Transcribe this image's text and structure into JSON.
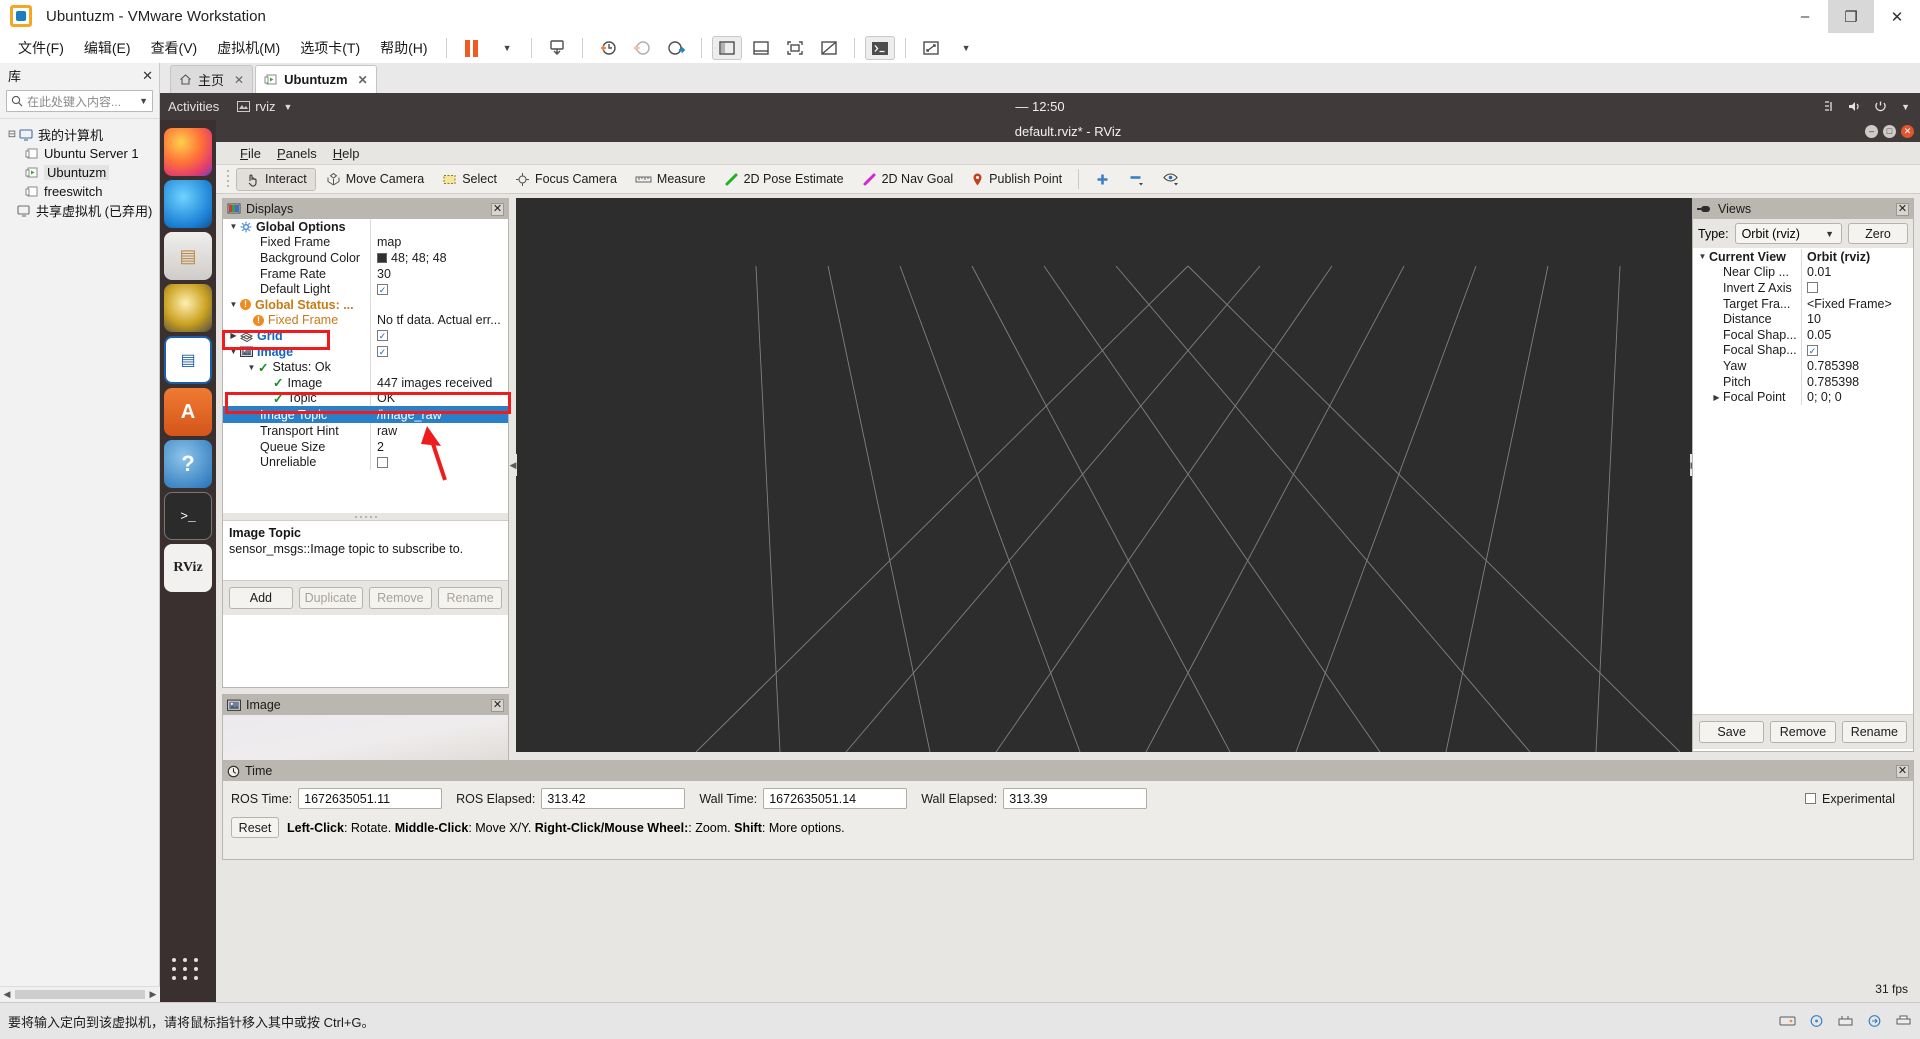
{
  "vmware": {
    "title": "Ubuntuzm - VMware Workstation",
    "menus": [
      "文件(F)",
      "编辑(E)",
      "查看(V)",
      "虚拟机(M)",
      "选项卡(T)",
      "帮助(H)"
    ],
    "window_controls": [
      "–",
      "❐",
      "✕"
    ],
    "library": {
      "header": "库",
      "close": "✕",
      "search_placeholder": "在此处键入内容...",
      "search_icon": "search-icon",
      "tree": [
        {
          "label": "我的计算机",
          "level": 0,
          "expander": "⊟",
          "icon": "computer-icon",
          "selected": false
        },
        {
          "label": "Ubuntu Server 1",
          "level": 1,
          "expander": "",
          "icon": "vm-icon",
          "selected": false
        },
        {
          "label": "Ubuntuzm",
          "level": 1,
          "expander": "",
          "icon": "vm-running-icon",
          "selected": true
        },
        {
          "label": "freeswitch",
          "level": 1,
          "expander": "",
          "icon": "vm-icon",
          "selected": false
        },
        {
          "label": "共享虚拟机 (已弃用)",
          "level": 0,
          "expander": "",
          "icon": "shared-vm-icon",
          "selected": false
        }
      ]
    },
    "tabs": [
      {
        "label": "主页",
        "icon": "home-icon",
        "active": false
      },
      {
        "label": "Ubuntuzm",
        "icon": "vm-running-icon",
        "active": true
      }
    ],
    "statusbar": {
      "message": "要将输入定向到该虚拟机，请将鼠标指针移入其中或按 Ctrl+G。"
    }
  },
  "gnome": {
    "activities": "Activities",
    "app_name": "rviz",
    "clock": "12:50",
    "clock_prefix": "—"
  },
  "rviz": {
    "window_title": "default.rviz* - RViz",
    "menus": [
      "File",
      "Panels",
      "Help"
    ],
    "toolbar": [
      {
        "label": "Interact",
        "icon": "hand-cursor-icon",
        "active": true
      },
      {
        "label": "Move Camera",
        "icon": "move-camera-icon",
        "active": false
      },
      {
        "label": "Select",
        "icon": "select-rect-icon",
        "active": false
      },
      {
        "label": "Focus Camera",
        "icon": "focus-camera-icon",
        "active": false
      },
      {
        "label": "Measure",
        "icon": "ruler-icon",
        "active": false
      },
      {
        "label": "2D Pose Estimate",
        "icon": "green-arrow-icon",
        "active": false
      },
      {
        "label": "2D Nav Goal",
        "icon": "magenta-arrow-icon",
        "active": false
      },
      {
        "label": "Publish Point",
        "icon": "map-pin-icon",
        "active": false
      }
    ],
    "toolbar_extra": [
      "plus-icon",
      "minus-icon",
      "eye-icon"
    ],
    "displays": {
      "title": "Displays",
      "icon": "displays-icon",
      "close": "✕",
      "rows": [
        {
          "name": "Global Options",
          "value": "",
          "indent": 1,
          "expander": "▼",
          "icon": "gear-icon",
          "bold": true,
          "style": "plain"
        },
        {
          "name": "Fixed Frame",
          "value": "map",
          "indent": 3,
          "expander": "",
          "icon": "",
          "style": "plain"
        },
        {
          "name": "Background Color",
          "value": "48; 48; 48",
          "indent": 3,
          "expander": "",
          "icon": "",
          "style": "swatch"
        },
        {
          "name": "Frame Rate",
          "value": "30",
          "indent": 3,
          "expander": "",
          "icon": "",
          "style": "plain"
        },
        {
          "name": "Default Light",
          "value": "✓",
          "indent": 3,
          "expander": "",
          "icon": "",
          "style": "checkbox"
        },
        {
          "name": "Global Status: ...",
          "value": "",
          "indent": 1,
          "expander": "▼",
          "icon": "warning-icon",
          "style": "orange"
        },
        {
          "name": "Fixed Frame",
          "value": "No tf data.  Actual err...",
          "indent": 3,
          "expander": "",
          "icon": "warning-icon",
          "style": "orange"
        },
        {
          "name": "Grid",
          "value": "✓",
          "indent": 1,
          "expander": "▶",
          "icon": "grid-icon",
          "style": "blue-checkbox"
        },
        {
          "name": "Image",
          "value": "✓",
          "indent": 1,
          "expander": "▼",
          "icon": "image-icon",
          "style": "blue-checkbox"
        },
        {
          "name": "Status: Ok",
          "value": "",
          "indent": 3,
          "expander": "▼",
          "icon": "check-icon",
          "style": "plain"
        },
        {
          "name": "Image",
          "value": "447 images received",
          "indent": 5,
          "expander": "",
          "icon": "check-icon",
          "style": "plain"
        },
        {
          "name": "Topic",
          "value": "OK",
          "indent": 5,
          "expander": "",
          "icon": "check-icon",
          "style": "plain"
        },
        {
          "name": "Image Topic",
          "value": "/image_raw",
          "indent": 4,
          "expander": "",
          "icon": "",
          "style": "selected"
        },
        {
          "name": "Transport Hint",
          "value": "raw",
          "indent": 4,
          "expander": "",
          "icon": "",
          "style": "plain"
        },
        {
          "name": "Queue Size",
          "value": "2",
          "indent": 4,
          "expander": "",
          "icon": "",
          "style": "plain"
        },
        {
          "name": "Unreliable",
          "value": "",
          "indent": 4,
          "expander": "",
          "icon": "",
          "style": "empty-checkbox"
        }
      ],
      "description_title": "Image Topic",
      "description_text": "sensor_msgs::Image topic to subscribe to.",
      "buttons": [
        {
          "label": "Add",
          "enabled": true
        },
        {
          "label": "Duplicate",
          "enabled": false
        },
        {
          "label": "Remove",
          "enabled": false
        },
        {
          "label": "Rename",
          "enabled": false
        }
      ]
    },
    "image_panel": {
      "title": "Image",
      "icon": "image-icon",
      "close": "✕"
    },
    "views": {
      "title": "Views",
      "icon": "views-camera-icon",
      "close": "✕",
      "type_label": "Type:",
      "type_value": "Orbit (rviz)",
      "zero_button": "Zero",
      "rows": [
        {
          "name": "Current View",
          "value": "Orbit (rviz)",
          "indent": 1,
          "expander": "▼",
          "bold": true,
          "style": "plain"
        },
        {
          "name": "Near Clip ...",
          "value": "0.01",
          "indent": 3,
          "expander": "",
          "style": "plain"
        },
        {
          "name": "Invert Z Axis",
          "value": "",
          "indent": 3,
          "expander": "",
          "style": "empty-checkbox"
        },
        {
          "name": "Target Fra...",
          "value": "<Fixed Frame>",
          "indent": 3,
          "expander": "",
          "style": "plain"
        },
        {
          "name": "Distance",
          "value": "10",
          "indent": 3,
          "expander": "",
          "style": "plain"
        },
        {
          "name": "Focal Shap...",
          "value": "0.05",
          "indent": 3,
          "expander": "",
          "style": "plain"
        },
        {
          "name": "Focal Shap...",
          "value": "✓",
          "indent": 3,
          "expander": "",
          "style": "checkbox"
        },
        {
          "name": "Yaw",
          "value": "0.785398",
          "indent": 3,
          "expander": "",
          "style": "plain"
        },
        {
          "name": "Pitch",
          "value": "0.785398",
          "indent": 3,
          "expander": "",
          "style": "plain"
        },
        {
          "name": "Focal Point",
          "value": "0; 0; 0",
          "indent": 2,
          "expander": "▶",
          "style": "plain"
        }
      ],
      "buttons": [
        "Save",
        "Remove",
        "Rename"
      ]
    },
    "time": {
      "title": "Time",
      "icon": "clock-icon",
      "close": "✕",
      "fields": [
        {
          "label": "ROS Time:",
          "value": "1672635051.11"
        },
        {
          "label": "ROS Elapsed:",
          "value": "313.42"
        },
        {
          "label": "Wall Time:",
          "value": "1672635051.14"
        },
        {
          "label": "Wall Elapsed:",
          "value": "313.39"
        }
      ],
      "experimental_label": "Experimental",
      "reset_button": "Reset",
      "hint_parts": [
        {
          "t": "Left-Click",
          "b": true
        },
        {
          "t": ": Rotate. ",
          "b": false
        },
        {
          "t": "Middle-Click",
          "b": true
        },
        {
          "t": ": Move X/Y. ",
          "b": false
        },
        {
          "t": "Right-Click/Mouse Wheel:",
          "b": true
        },
        {
          "t": ": Zoom. ",
          "b": false
        },
        {
          "t": "Shift",
          "b": true
        },
        {
          "t": ": More options.",
          "b": false
        }
      ],
      "fps": "31 fps"
    }
  },
  "colors": {
    "accent_blue": "#2a7fc9",
    "annotation_red": "#ee1c1c",
    "orange": "#ef8b20",
    "link_blue": "#1565c0"
  }
}
